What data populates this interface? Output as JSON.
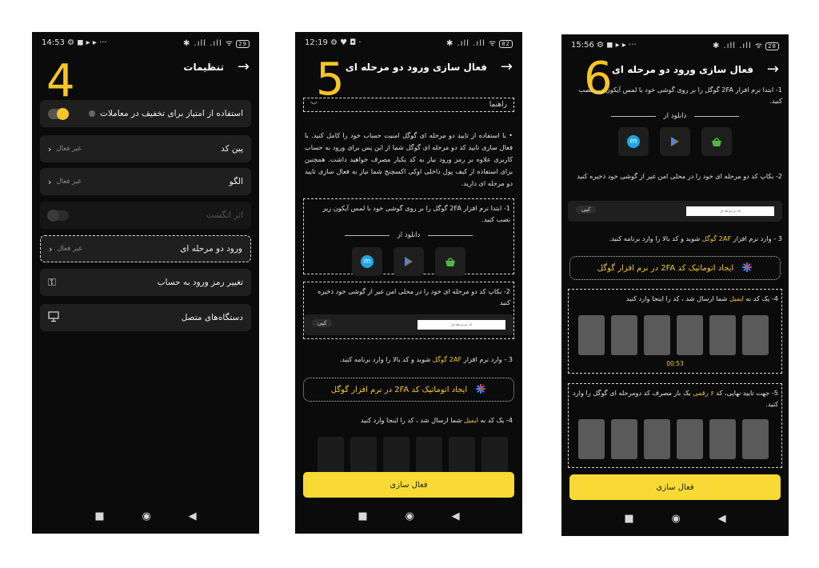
{
  "phone4": {
    "status": {
      "time": "14:53 ⚙ ◼ ▸ ▸ ···",
      "icons": "✱ .ıll .ıll ᯤ",
      "battery": "29"
    },
    "step_number": "4",
    "back_icon": "arrow-right-icon",
    "title": "تنظیمات",
    "rows": [
      {
        "label": "استفاده از امتیاز برای تخفیف در معاملات"
      },
      {
        "label": "پین کد",
        "status": "غیر فعال"
      },
      {
        "label": "الگو",
        "status": "غیر فعال"
      },
      {
        "label": "اثر انگشت"
      },
      {
        "label": "ورود دو مرحله ای",
        "status": "غیر فعال"
      },
      {
        "label": "تغییر رمز ورود به حساب"
      },
      {
        "label": "دستگاه‌های متصل"
      }
    ],
    "colors": {
      "accent": "#f6c623",
      "row_bg": "#1f1f1f",
      "screen_bg": "#0b0b0b"
    }
  },
  "phone5": {
    "status": {
      "time": "12:19 ⚙ ♥ ◘ ·",
      "icons": "✱ .ıll .ıll ᯤ",
      "battery": "82"
    },
    "step_number": "5",
    "title": "فعال سازی ورود دو مرحله ای",
    "guide_label": "راهنما",
    "intro": "• با استفاده از تایید دو مرحله ای گوگل امنیت حساب خود را کامل کنید. با فعال سازی تایید کد دو مرحله ای گوگل شما از این پس برای ورود به حساب کاربری علاوه بر رمز ورود نیاز به کد یکبار مصرف خواهید داشت. همچنین برای استفاده از کیف پول داخلی اوکی اکسچنج شما نیاز به فعال سازی تایید دو مرحله ای دارید.",
    "step1": "1- ابتدا نرم افزار 2FA گوگل را بر روی گوشی خود با لمس آیکون زیر نصب کنید.",
    "download_from": "دانلود از",
    "step2": "2- بکاپ کد دو مرحله ای خود را در محلی امن غیر از گوشی خود ذخیره کنید",
    "copy_label": "کپی",
    "code_text": "کد دو مرحله ای",
    "step3_pre": "3 - وارد نرم افزار",
    "step3_hl": "2AF گوگل",
    "step3_post": "شوید و کد بالا را وارد برنامه کنید.",
    "auto_label": "ایجاد اتوماتیک کد 2FA در نرم افزار گوگل",
    "step4_pre": "4- یک کد به",
    "step4_hl": "ایمیل",
    "step4_post": "شما ارسال شد ، کد را اینجا وارد کنید",
    "activate": "فعال سازی"
  },
  "phone6": {
    "status": {
      "time": "15:56 ⚙ ◼ ▸ ▸ ···",
      "icons": "✱ .ıll .ıll ᯤ",
      "battery": "28"
    },
    "step_number": "6",
    "title": "فعال سازی ورود دو مرحله ای",
    "step1": "1- ابتدا نرم افزار 2FA گوگل را بر روی گوشی خود با لمس آیکون زیر نصب کنید.",
    "download_from": "دانلود از",
    "step2": "2- بکاپ کد دو مرحله ای خود را در محلی امن غیر از گوشی خود ذخیره کنید",
    "copy_label": "کپی",
    "code_text": "کد دو مرحله ای",
    "step3_pre": "3 - وارد نرم افزار",
    "step3_hl": "2AF گوگل",
    "step3_post": "شوید و کد بالا را وارد برنامه کنید.",
    "auto_label": "ایجاد اتوماتیک کد 2FA در نرم افزار گوگل",
    "step4_pre": "4- یک کد به",
    "step4_hl": "ایمیل",
    "step4_post": "شما ارسال شد ، کد را اینجا وارد کنید",
    "timer": "00:53",
    "step5_pre": "5- جهت تایید نهایی، کد",
    "step5_hl": "۶ رقمی",
    "step5_post": "یک بار مصرف کد دومرحله ای گوگل را وارد کنید.",
    "activate": "فعال سازی"
  },
  "navbar": {
    "square": "■",
    "circle": "◉",
    "triangle": "◀"
  }
}
